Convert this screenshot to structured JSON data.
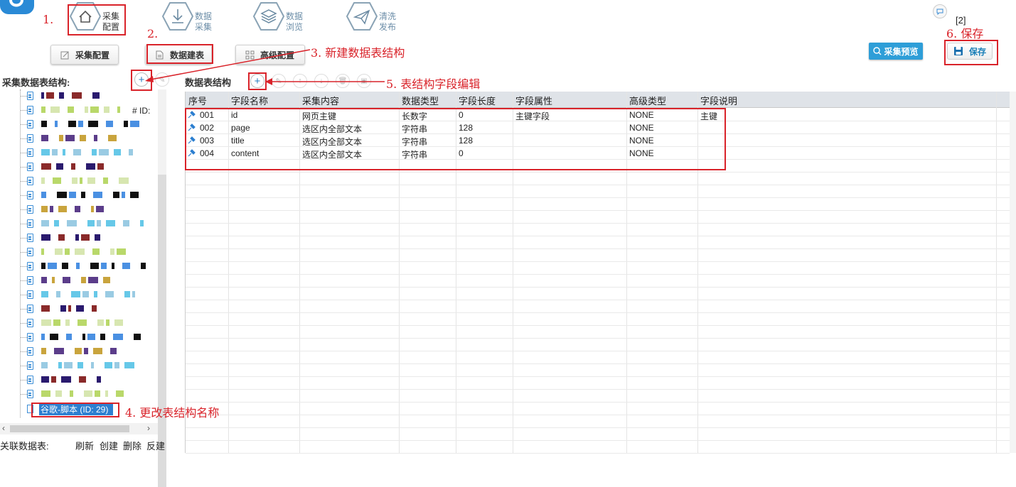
{
  "nav": {
    "items": [
      {
        "line1": "采集",
        "line2": "配置"
      },
      {
        "line1": "数据",
        "line2": "采集"
      },
      {
        "line1": "数据",
        "line2": "浏览"
      },
      {
        "line1": "清洗",
        "line2": "发布"
      }
    ],
    "badge": "[2]"
  },
  "toolbar": {
    "collect_config": "采集配置",
    "data_table": "数据建表",
    "advanced_config": "高级配置",
    "preview": "采集预览",
    "save": "保存"
  },
  "left_panel": {
    "title": "采集数据表结构:",
    "selected_item": "谷歌-脚本 (ID: 29)",
    "partial_text": "# ID:",
    "related_label": "关联数据表:",
    "actions": [
      "刷新",
      "创建",
      "删除",
      "反建"
    ]
  },
  "right_panel": {
    "title": "数据表结构"
  },
  "table": {
    "columns": [
      "序号",
      "字段名称",
      "采集内容",
      "数据类型",
      "字段长度",
      "字段属性",
      "高级类型",
      "字段说明"
    ],
    "rows": [
      [
        "001",
        "id",
        "网页主键",
        "长数字",
        "0",
        "主键字段",
        "NONE",
        "主键"
      ],
      [
        "002",
        "page",
        "选区内全部文本",
        "字符串",
        "128",
        "",
        "NONE",
        ""
      ],
      [
        "003",
        "title",
        "选区内全部文本",
        "字符串",
        "128",
        "",
        "NONE",
        ""
      ],
      [
        "004",
        "content",
        "选区内全部文本",
        "字符串",
        "0",
        "",
        "NONE",
        ""
      ]
    ]
  },
  "annotations": {
    "a1": "1.",
    "a2": "2.",
    "a3": "3. 新建数据表结构",
    "a4": "4. 更改表结构名称",
    "a5": "5. 表结构字段编辑",
    "a6": "6. 保存"
  },
  "colors": {
    "accent": "#2e9ed8",
    "annotation_red": "#d9232a",
    "selected_blue": "#2c7fd0"
  }
}
